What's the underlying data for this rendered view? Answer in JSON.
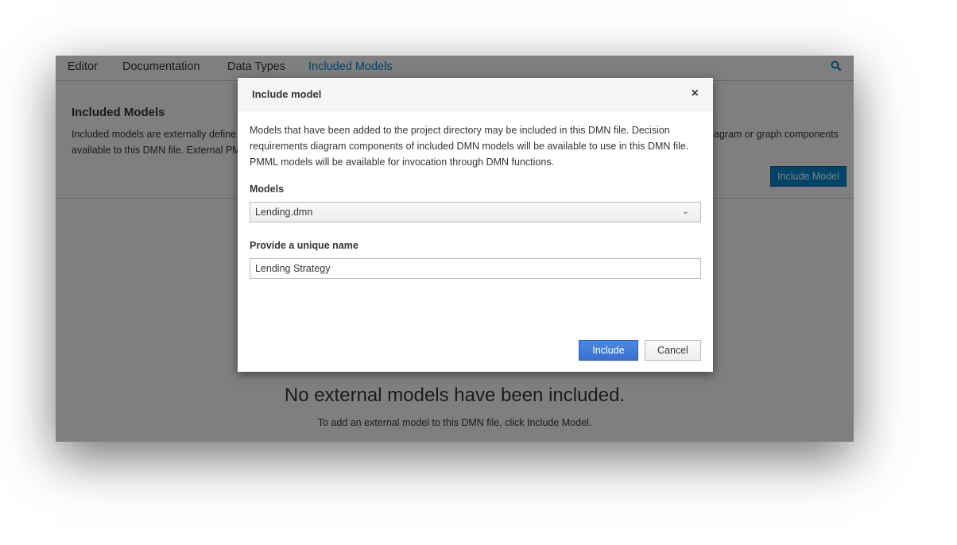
{
  "tabs": [
    "Editor",
    "Documentation",
    "Data Types",
    "Included Models"
  ],
  "section": {
    "title": "Included Models",
    "line1_left": "Included models are externally define",
    "line1_right": "agram or graph components",
    "line2_left": "available to this DMN file. External PM",
    "button": "Include Model"
  },
  "empty": {
    "title": "No external models have been included.",
    "subtitle": "To add an external model to this DMN file, click Include Model."
  },
  "modal": {
    "title": "Include model",
    "close": "×",
    "description": "Models that have been added to the project directory may be included in this DMN file. Decision requirements diagram components of included DMN models will be available to use in this DMN file. PMML models will be available for invocation through DMN functions.",
    "models_label": "Models",
    "models_value": "Lending.dmn",
    "name_label": "Provide a unique name",
    "name_value": "Lending Strategy",
    "include": "Include",
    "cancel": "Cancel"
  },
  "colors": {
    "accent": "#0088ce",
    "primary": "#3f7bd6"
  }
}
